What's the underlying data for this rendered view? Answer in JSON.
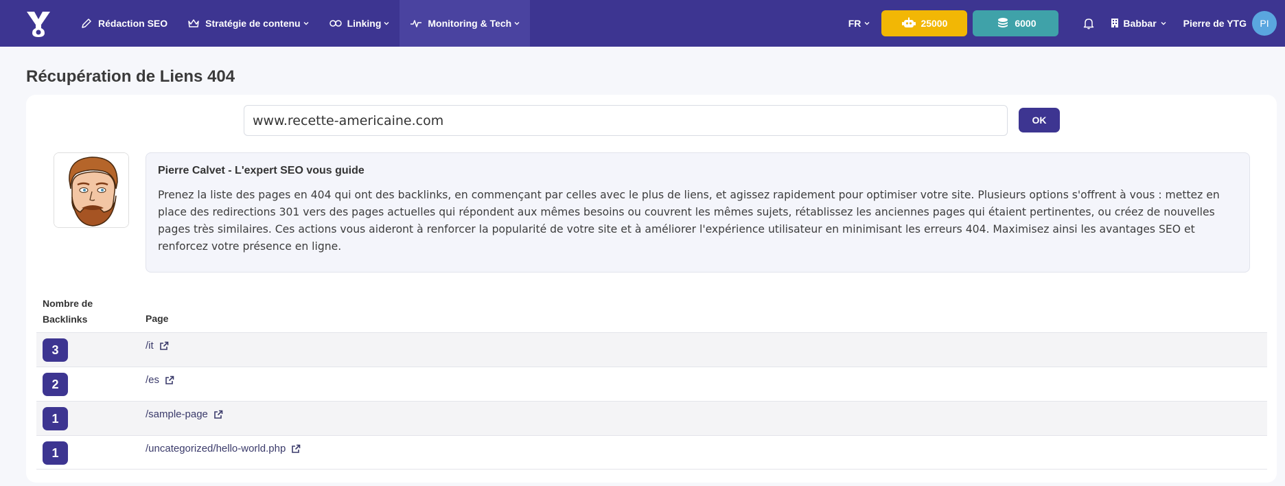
{
  "nav": {
    "items": [
      {
        "label": "Rédaction SEO",
        "icon": "pencil-icon",
        "chevron": false
      },
      {
        "label": "Stratégie de contenu",
        "icon": "crown-icon",
        "chevron": true
      },
      {
        "label": "Linking",
        "icon": "link-icon",
        "chevron": true
      },
      {
        "label": "Monitoring & Tech",
        "icon": "pulse-icon",
        "chevron": true,
        "active": true
      }
    ],
    "lang": "FR",
    "credits_ai": "25000",
    "credits_coins": "6000",
    "workspace": "Babbar",
    "user_name": "Pierre de YTG",
    "user_initials": "PI"
  },
  "page": {
    "title": "Récupération de Liens 404",
    "url_value": "www.recette-americaine.com",
    "ok_label": "OK"
  },
  "expert": {
    "title": "Pierre Calvet - L'expert SEO vous guide",
    "text": "Prenez la liste des pages en 404 qui ont des backlinks, en commençant par celles avec le plus de liens, et agissez rapidement pour optimiser votre site. Plusieurs options s'offrent à vous : mettez en place des redirections 301 vers des pages actuelles qui répondent aux mêmes besoins ou couvrent les mêmes sujets, rétablissez les anciennes pages qui étaient pertinentes, ou créez de nouvelles pages très similaires. Ces actions vous aideront à renforcer la popularité de votre site et à améliorer l'expérience utilisateur en minimisant les erreurs 404. Maximisez ainsi les avantages SEO et renforcez votre présence en ligne."
  },
  "table": {
    "col_count": "Nombre de Backlinks",
    "col_page": "Page",
    "rows": [
      {
        "count": "3",
        "page": "/it"
      },
      {
        "count": "2",
        "page": "/es"
      },
      {
        "count": "1",
        "page": "/sample-page"
      },
      {
        "count": "1",
        "page": "/uncategorized/hello-world.php"
      }
    ]
  },
  "colors": {
    "brand": "#3d3591",
    "yellow": "#f2b705",
    "teal": "#3fa2a9"
  }
}
